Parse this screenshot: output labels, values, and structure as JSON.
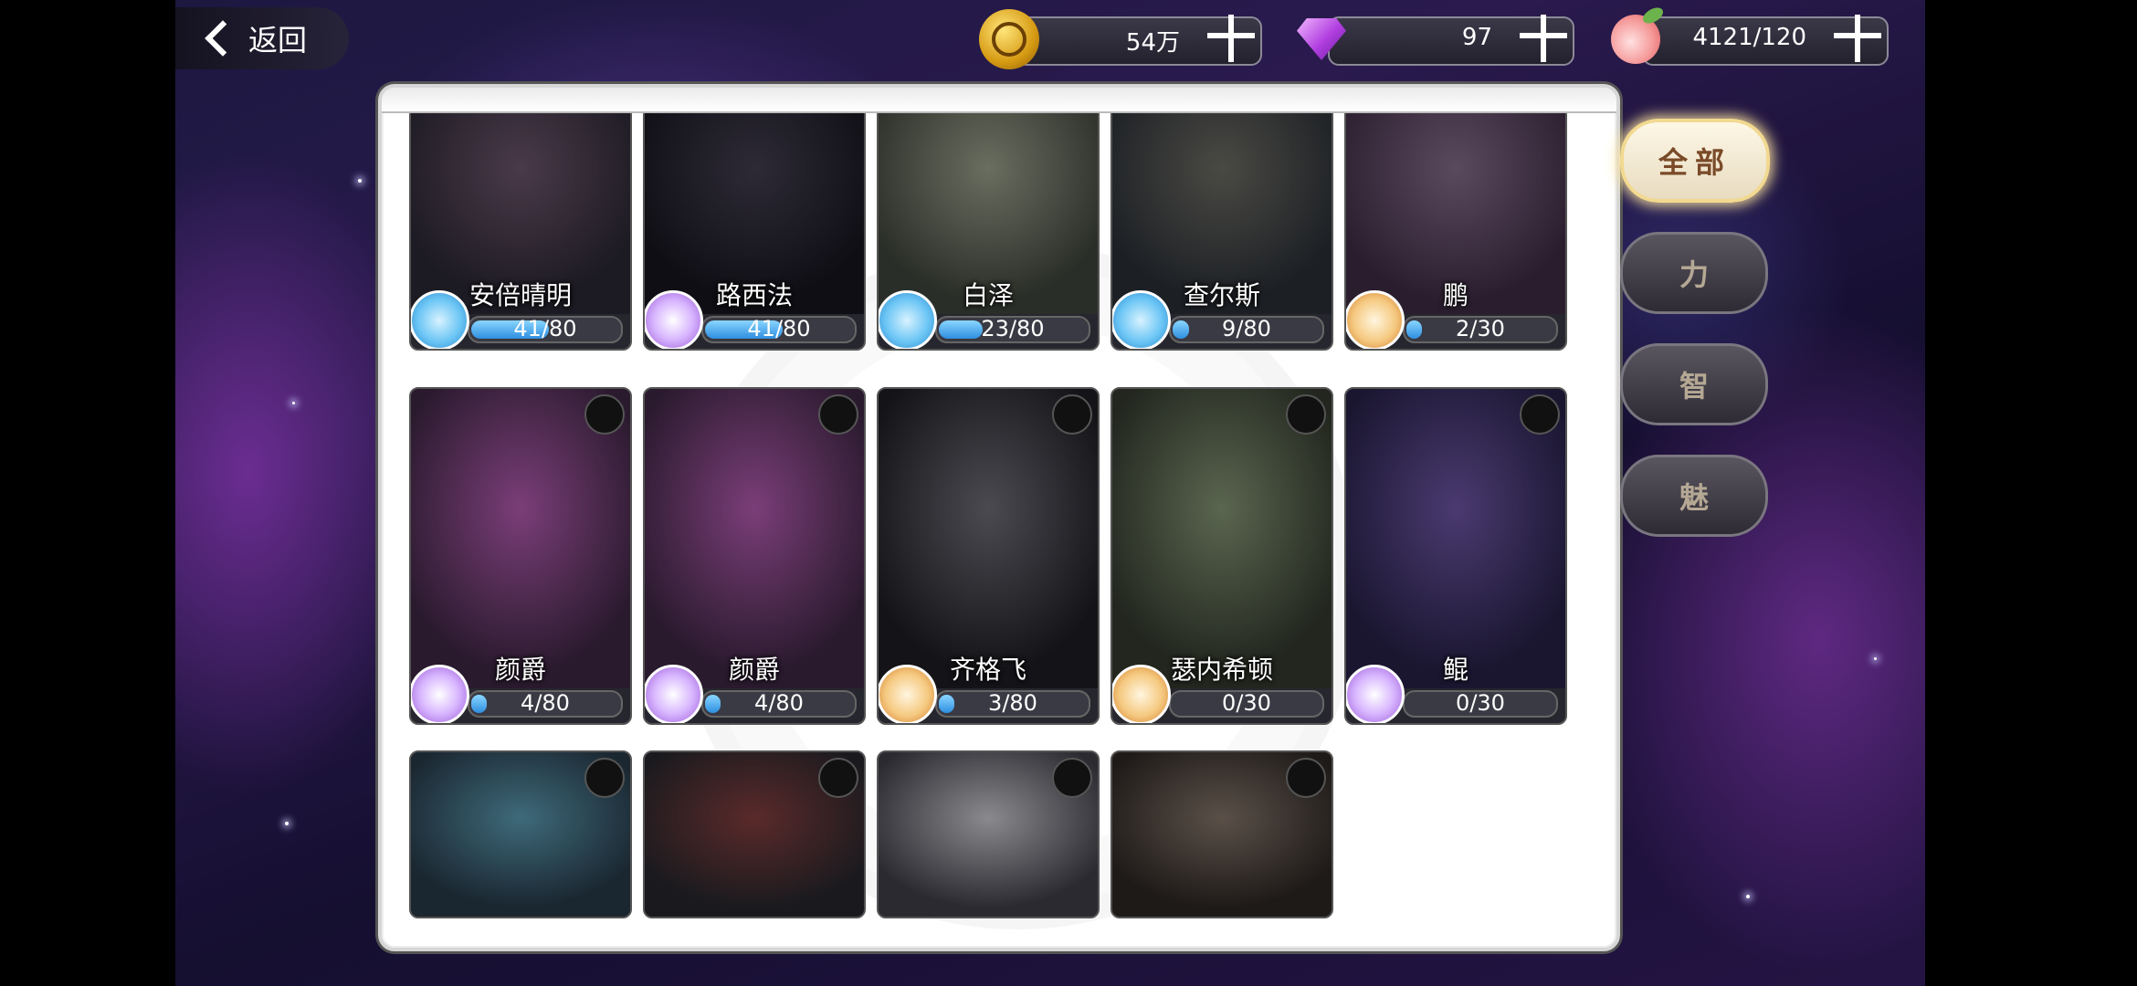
{
  "header": {
    "back_label": "返回",
    "resources": [
      {
        "name": "gold",
        "icon": "coin-icon",
        "value": "54万"
      },
      {
        "name": "diamond",
        "icon": "gem-icon",
        "value": "97"
      },
      {
        "name": "stamina",
        "icon": "peach-icon",
        "value": "4121/120"
      }
    ]
  },
  "filters": [
    {
      "label": "全部",
      "active": true
    },
    {
      "label": "力",
      "active": false
    },
    {
      "label": "智",
      "active": false
    },
    {
      "label": "魅",
      "active": false
    }
  ],
  "cards": [
    {
      "name": "安倍晴明",
      "progress": "41/80",
      "fraction": 0.51,
      "attribute": "blue",
      "art": [
        "#4a3a4a",
        "#1c1a22"
      ]
    },
    {
      "name": "路西法",
      "progress": "41/80",
      "fraction": 0.51,
      "attribute": "purple",
      "art": [
        "#2d2a36",
        "#0f0e14"
      ]
    },
    {
      "name": "白泽",
      "progress": "23/80",
      "fraction": 0.29,
      "attribute": "blue",
      "art": [
        "#6a6e60",
        "#2a2e28"
      ]
    },
    {
      "name": "查尔斯",
      "progress": "9/80",
      "fraction": 0.11,
      "attribute": "blue",
      "art": [
        "#4a4a44",
        "#1c1f24"
      ]
    },
    {
      "name": "鹏",
      "progress": "2/30",
      "fraction": 0.07,
      "attribute": "gold",
      "art": [
        "#5a4a5e",
        "#2a1e2e"
      ]
    },
    {
      "name": "颜爵",
      "progress": "4/80",
      "fraction": 0.05,
      "attribute": "purple",
      "art": [
        "#7a3e78",
        "#2a1a2e"
      ]
    },
    {
      "name": "颜爵",
      "progress": "4/80",
      "fraction": 0.05,
      "attribute": "purple",
      "art": [
        "#7a3e78",
        "#2a1a2e"
      ]
    },
    {
      "name": "齐格飞",
      "progress": "3/80",
      "fraction": 0.04,
      "attribute": "gold",
      "art": [
        "#4a4a50",
        "#141418"
      ]
    },
    {
      "name": "瑟内希顿",
      "progress": "0/30",
      "fraction": 0,
      "attribute": "gold",
      "art": [
        "#5a6650",
        "#22261e"
      ]
    },
    {
      "name": "鲲",
      "progress": "0/30",
      "fraction": 0,
      "attribute": "purple",
      "art": [
        "#4a3a70",
        "#1a1630"
      ]
    },
    {
      "name": "",
      "progress": "",
      "fraction": 0,
      "attribute": "",
      "art": [
        "#3e6a7a",
        "#1a2630"
      ]
    },
    {
      "name": "",
      "progress": "",
      "fraction": 0,
      "attribute": "",
      "art": [
        "#5a2a2a",
        "#1a1a1e"
      ]
    },
    {
      "name": "",
      "progress": "",
      "fraction": 0,
      "attribute": "",
      "art": [
        "#8a8a8e",
        "#2a2a30"
      ]
    },
    {
      "name": "",
      "progress": "",
      "fraction": 0,
      "attribute": "",
      "art": [
        "#5a5048",
        "#1e1a18"
      ]
    }
  ]
}
